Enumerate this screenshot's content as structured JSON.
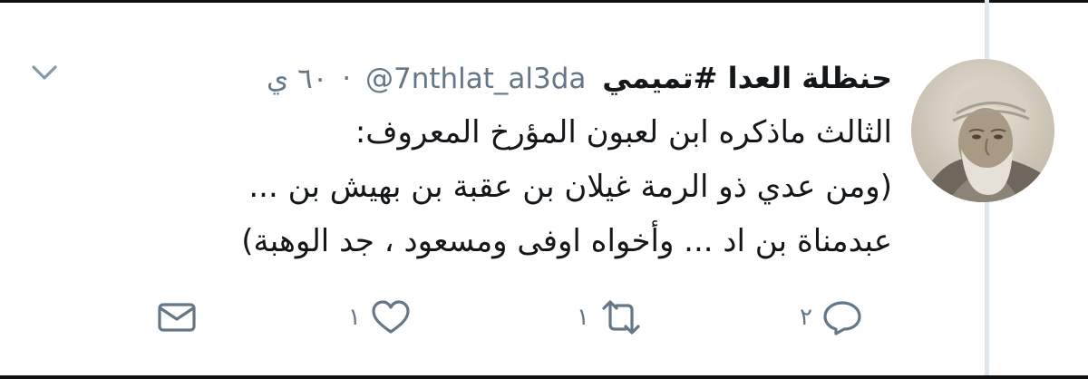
{
  "tweet": {
    "display_name": "حنظلة العدا #تميمي",
    "handle": "@7nthlat_al3da",
    "separator": "·",
    "time": "٦٠ ي",
    "text_lines": [
      "الثالث ماذكره ابن لعبون المؤرخ المعروف:",
      "(ومن عدي ذو الرمة غيلان بن عقبة بن بهيش بن ...",
      "عبدمناة بن اد ... وأخواه اوفى ومسعود ، جد الوهبة)"
    ]
  },
  "actions": {
    "reply_count": "٢",
    "retweet_count": "١",
    "like_count": "١"
  },
  "icons": {
    "caret": "chevron-down-icon",
    "reply": "reply-icon",
    "retweet": "retweet-icon",
    "like": "heart-icon",
    "dm": "envelope-icon"
  },
  "colors": {
    "text": "#14171a",
    "secondary": "#657786",
    "icon": "#657786"
  }
}
